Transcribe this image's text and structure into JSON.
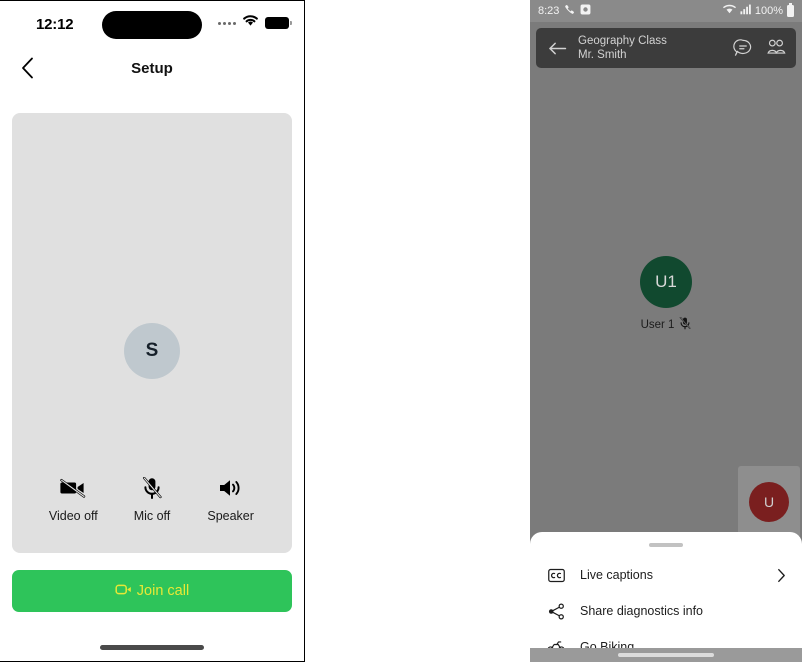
{
  "left_phone": {
    "status_bar": {
      "time": "12:12",
      "cellular_icon": "cellular-dots-icon",
      "wifi_icon": "wifi-icon",
      "battery_icon": "battery-full-icon"
    },
    "nav": {
      "back_icon": "chevron-left-icon",
      "title": "Setup"
    },
    "preview": {
      "avatar_initial": "S",
      "avatar_bg": "#bfc8ce",
      "card_bg": "#e0e0e0"
    },
    "controls": [
      {
        "icon": "video-off-icon",
        "label": "Video off"
      },
      {
        "icon": "mic-off-icon",
        "label": "Mic off"
      },
      {
        "icon": "speaker-icon",
        "label": "Speaker"
      }
    ],
    "join_button": {
      "label": "Join call",
      "icon": "video-camera-icon",
      "bg_color": "#2ec45a",
      "text_color": "#e8e836"
    },
    "home_indicator": "home-indicator"
  },
  "right_phone": {
    "status_bar": {
      "time": "8:23",
      "phone_icon": "phone-icon",
      "camera_icon": "camera-icon",
      "wifi_icon": "wifi-icon",
      "signal_icon": "signal-bars-icon",
      "battery_percent": "100%",
      "battery_icon": "battery-full-icon"
    },
    "header": {
      "back_icon": "arrow-left-icon",
      "title": "Geography Class",
      "subtitle": "Mr. Smith",
      "chat_icon": "chat-bubble-icon",
      "participants_icon": "people-icon"
    },
    "remote_participant": {
      "avatar_initials": "U1",
      "avatar_bg": "#11492f",
      "name": "User 1",
      "mute_icon": "mic-off-icon"
    },
    "self_view": {
      "avatar_initial": "U",
      "avatar_bg": "#7a1f1f"
    },
    "bottom_sheet": {
      "grabber": "sheet-grabber",
      "items": [
        {
          "icon": "closed-captions-icon",
          "label": "Live captions",
          "trailing_icon": "chevron-right-icon"
        },
        {
          "icon": "share-nodes-icon",
          "label": "Share diagnostics info",
          "trailing_icon": ""
        },
        {
          "icon": "bicycle-icon",
          "label": "Go Biking",
          "trailing_icon": ""
        }
      ]
    },
    "nav_pill": "gesture-nav-pill"
  }
}
